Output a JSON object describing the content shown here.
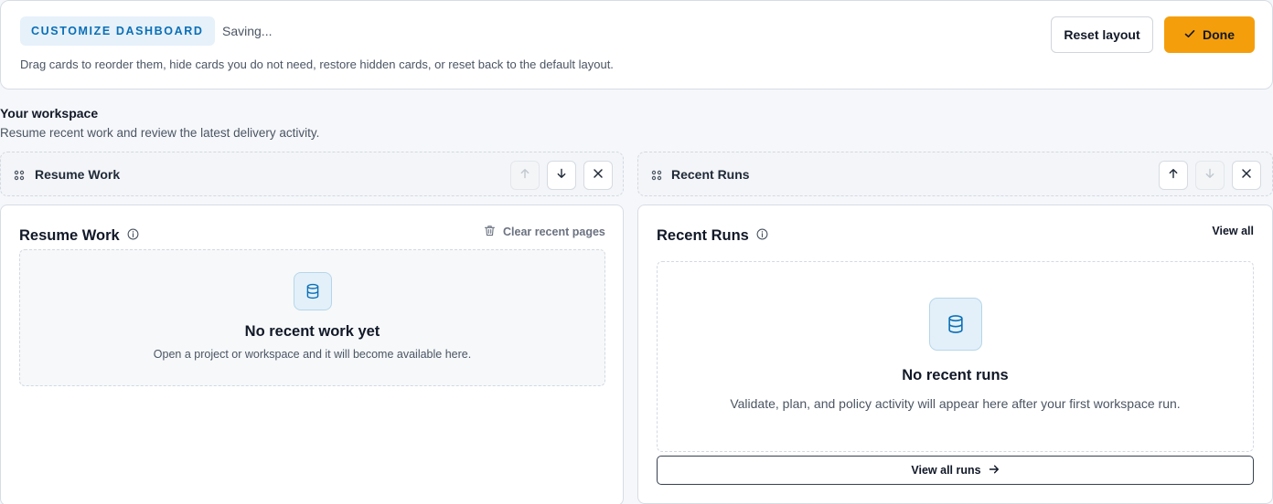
{
  "banner": {
    "badge": "CUSTOMIZE DASHBOARD",
    "status": "Saving...",
    "description": "Drag cards to reorder them, hide cards you do not need, restore hidden cards, or reset back to the default layout.",
    "reset_label": "Reset layout",
    "done_label": "Done"
  },
  "workspace": {
    "title": "Your workspace",
    "subtitle": "Resume recent work and review the latest delivery activity."
  },
  "dragbars": [
    {
      "label": "Resume Work",
      "move_up_enabled": false,
      "move_down_enabled": true
    },
    {
      "label": "Recent Runs",
      "move_up_enabled": true,
      "move_down_enabled": false
    }
  ],
  "resume_card": {
    "title": "Resume Work",
    "clear_label": "Clear recent pages",
    "empty_title": "No recent work yet",
    "empty_text": "Open a project or workspace and it will become available here."
  },
  "runs_card": {
    "title": "Recent Runs",
    "view_all_label": "View all",
    "empty_title": "No recent runs",
    "empty_text": "Validate, plan, and policy activity will appear here after your first workspace run.",
    "view_all_runs_label": "View all runs"
  },
  "colors": {
    "accent": "#f59e0b",
    "badge_text": "#0a6fb6",
    "icon_blue": "#0a6fb6"
  },
  "icons": {
    "done": "check-icon",
    "drag": "drag-handle-icon",
    "up": "arrow-up-icon",
    "down": "arrow-down-icon",
    "hide": "close-icon",
    "info": "info-icon",
    "clear": "trash-icon",
    "empty": "database-icon",
    "view_runs": "arrow-right-icon"
  }
}
